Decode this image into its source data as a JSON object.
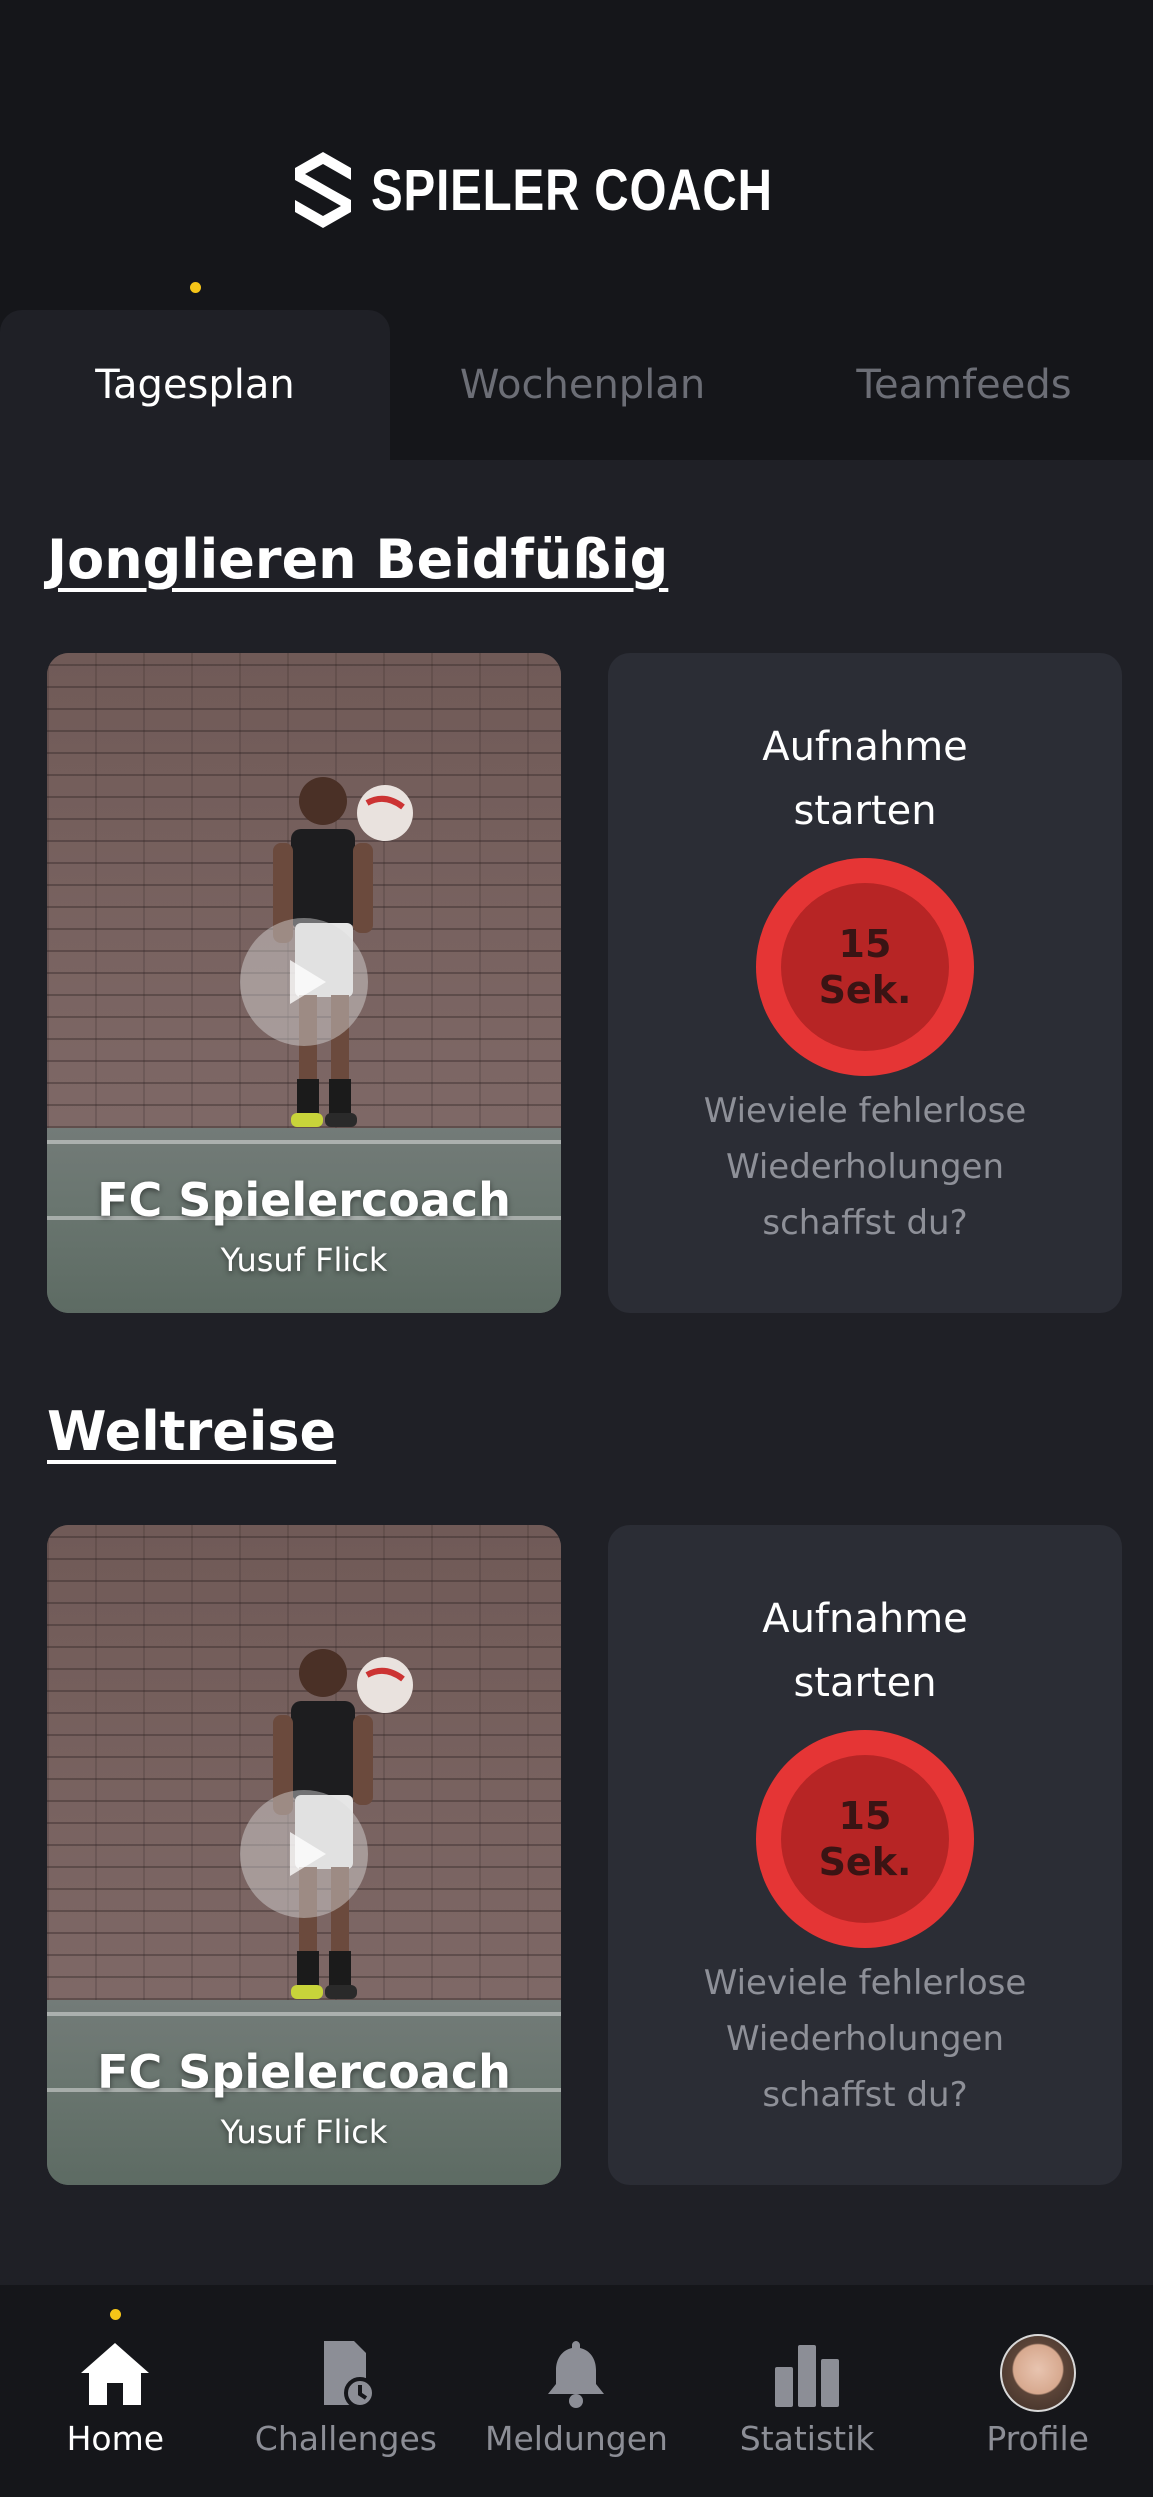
{
  "header": {
    "logo_text": "SPIELER COACH",
    "logo_icon": "spielercoach-logo-icon"
  },
  "tabs": [
    {
      "label": "Tagesplan",
      "active": true
    },
    {
      "label": "Wochenplan",
      "active": false
    },
    {
      "label": "Teamfeeds",
      "active": false
    }
  ],
  "exercises": [
    {
      "title": "Jonglieren Beidfüßig",
      "video": {
        "title": "FC Spielercoach",
        "subtitle": "Yusuf Flick"
      },
      "record": {
        "title_line1": "Aufnahme",
        "title_line2": "starten",
        "duration_value": "15",
        "duration_unit": "Sek.",
        "desc_line1": "Wieviele fehlerlose",
        "desc_line2": "Wiederholungen",
        "desc_line3": "schaffst du?"
      }
    },
    {
      "title": "Weltreise",
      "video": {
        "title": "FC Spielercoach",
        "subtitle": "Yusuf Flick"
      },
      "record": {
        "title_line1": "Aufnahme",
        "title_line2": "starten",
        "duration_value": "15",
        "duration_unit": "Sek.",
        "desc_line1": "Wieviele fehlerlose",
        "desc_line2": "Wiederholungen",
        "desc_line3": "schaffst du?"
      }
    }
  ],
  "bottom_nav": [
    {
      "label": "Home",
      "icon": "home-icon",
      "active": true
    },
    {
      "label": "Challenges",
      "icon": "challenges-icon",
      "active": false
    },
    {
      "label": "Meldungen",
      "icon": "bell-icon",
      "active": false
    },
    {
      "label": "Statistik",
      "icon": "bar-chart-icon",
      "active": false
    },
    {
      "label": "Profile",
      "icon": "avatar",
      "active": false
    }
  ],
  "colors": {
    "accent_dot": "#f5c518",
    "record_red": "#e53535",
    "background": "#1a1b1f",
    "card": "#2b2d35"
  }
}
